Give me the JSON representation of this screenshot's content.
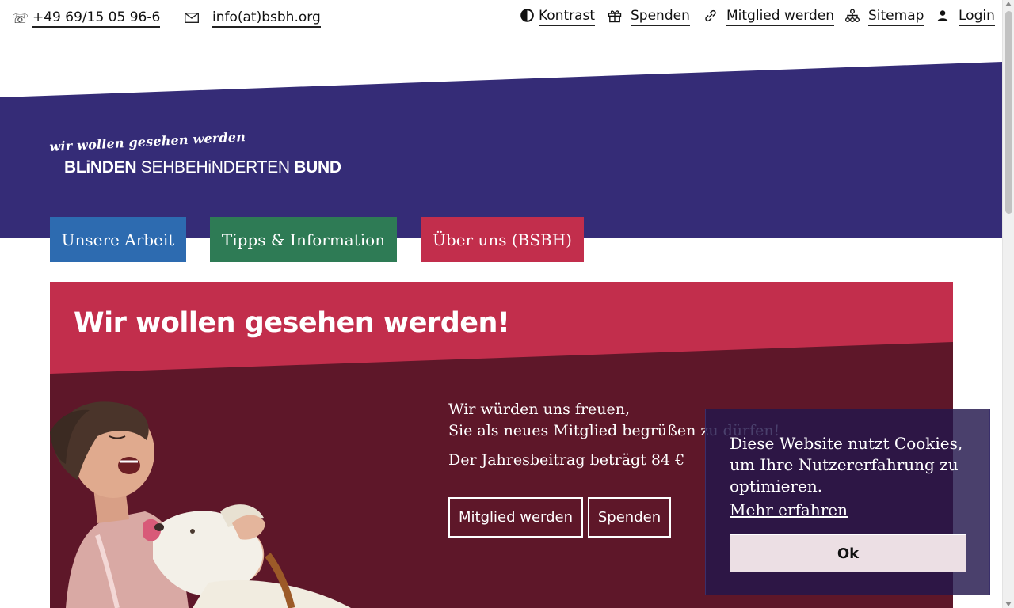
{
  "colors": {
    "header_purple": "#352c77",
    "nav_blue": "#2d6bb0",
    "nav_green": "#2e7b55",
    "nav_red": "#c22e4c",
    "hero_red": "#c22e4c",
    "hero_dark": "#5e1729",
    "cookie_bg": "#22164c"
  },
  "topbar": {
    "phone_icon": "phone-icon",
    "phone": "+49 69/15 05 96-6",
    "email_icon": "envelope-icon",
    "email": "info(at)bsbh.org",
    "links": [
      {
        "icon": "contrast-icon",
        "label": "Kontrast"
      },
      {
        "icon": "gift-icon",
        "label": "Spenden"
      },
      {
        "icon": "link-icon",
        "label": "Mitglied werden"
      },
      {
        "icon": "sitemap-icon",
        "label": "Sitemap"
      },
      {
        "icon": "user-icon",
        "label": "Login"
      }
    ]
  },
  "logo": {
    "slogan": "wir wollen gesehen werden",
    "name_part1": "BLiNDEN",
    "name_part2": "SEHBEHiNDERTEN",
    "name_part3": "BUND"
  },
  "nav": [
    {
      "label": "Unsere Arbeit"
    },
    {
      "label": "Tipps & Information"
    },
    {
      "label": "Über uns (BSBH)"
    }
  ],
  "hero": {
    "title": "Wir wollen gesehen werden!",
    "line1": "Wir würden uns freuen,",
    "line2": "Sie als neues Mitglied begrüßen zu dürfen!",
    "fee": "Der Jahresbeitrag beträgt 84 €",
    "btn_member": "Mitglied werden",
    "btn_donate": "Spenden"
  },
  "cookie": {
    "message": "Diese Website nutzt Cookies, um Ihre Nutzererfahrung zu optimieren.",
    "more": "Mehr erfahren",
    "ok": "Ok"
  }
}
